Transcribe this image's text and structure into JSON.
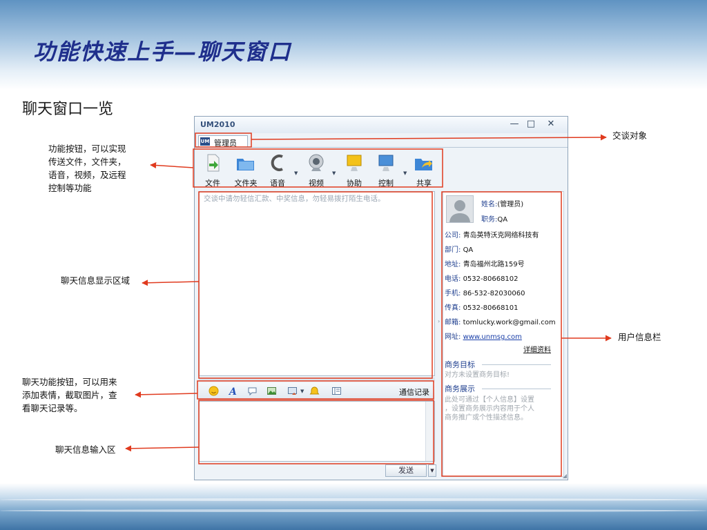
{
  "slide": {
    "title": "功能快速上手—聊天窗口",
    "subtitle": "聊天窗口一览"
  },
  "annotations": {
    "function_buttons": [
      "功能按钮，可以实现",
      "传送文件，文件夹，",
      "语音，视频，及远程",
      "控制等功能"
    ],
    "chat_target": "交谈对象",
    "display_area": "聊天信息显示区域",
    "chat_func_buttons": [
      "聊天功能按钮，可以用来",
      "添加表情，截取图片，查",
      "看聊天记录等。"
    ],
    "input_area": "聊天信息输入区",
    "user_info": "用户信息栏"
  },
  "window": {
    "app_title": "UM2010",
    "controls": {
      "minimize": "—",
      "restore": "□",
      "close": "✕"
    },
    "tab": {
      "logo": "UM",
      "label": "管理员"
    },
    "toolbar": [
      {
        "label": "文件"
      },
      {
        "label": "文件夹"
      },
      {
        "label": "语音"
      },
      {
        "label": "视频"
      },
      {
        "label": "协助"
      },
      {
        "label": "控制"
      },
      {
        "label": "共享"
      }
    ],
    "chat_hint": "交谈中请勿轻信汇款、中奖信息，勿轻易拨打陌生电话。",
    "history_label": "通信记录",
    "send_label": "发送",
    "collapse_arrow": "›",
    "dropdown_caret": "▼",
    "resize_grip": "◢"
  },
  "user_info": {
    "name_label": "姓名:",
    "name": "(管理员)",
    "position_label": "职务:",
    "position": "QA",
    "company_label": "公司:",
    "company": "青岛英特沃克网络科技有",
    "dept_label": "部门:",
    "dept": "QA",
    "address_label": "地址:",
    "address": "青岛福州北路159号",
    "phone_label": "电话:",
    "phone": "0532-80668102",
    "mobile_label": "手机:",
    "mobile": "86-532-82030060",
    "fax_label": "传真:",
    "fax": "0532-80668101",
    "email_label": "邮箱:",
    "email": "tomlucky.work@gmail.com",
    "web_label": "网址:",
    "web": "www.unmsg.com",
    "details_link": "详细资料",
    "biz_goal_title": "商务目标",
    "biz_goal_text": "对方未设置商务目标!",
    "biz_show_title": "商务展示",
    "biz_show_text": [
      "此处可通过【个人信息】设置",
      "，设置商务展示内容用于个人",
      "商务推广或个性描述信息。"
    ]
  },
  "colors": {
    "title": "#1f2f8c",
    "highlight": "#e03a1e",
    "label_blue": "#1f3f8f"
  }
}
